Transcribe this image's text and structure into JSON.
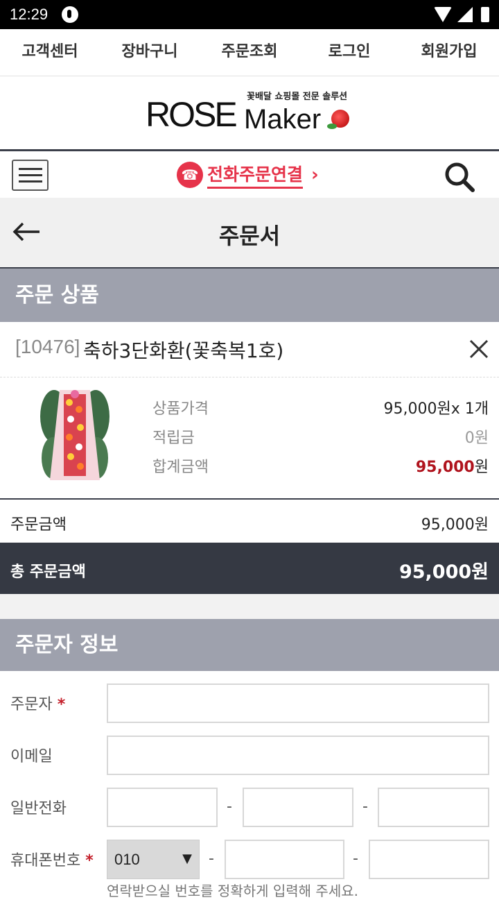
{
  "status_bar": {
    "time": "12:29"
  },
  "top_nav": [
    "고객센터",
    "장바구니",
    "주문조회",
    "로그인",
    "회원가입"
  ],
  "logo": {
    "tagline": "꽃배달 쇼핑몰 전문 솔루션",
    "rose": "ROSE",
    "maker": "Maker"
  },
  "toolbar": {
    "phone_order": "전화주문연결",
    "phone_glyph": "☎",
    "chevron": "›"
  },
  "page": {
    "title": "주문서"
  },
  "order_products": {
    "section_title": "주문 상품",
    "code": "[10476]",
    "name": "축하3단화환(꽃축복1호)",
    "price_label": "상품가격",
    "price_value": "95,000원x 1개",
    "points_label": "적립금",
    "points_value": "0원",
    "subtotal_label": "합계금액",
    "subtotal_amount": "95,000",
    "subtotal_unit": "원"
  },
  "summary": {
    "order_amount_label": "주문금액",
    "order_amount_value": "95,000원",
    "total_label": "총 주문금액",
    "total_value": "95,000원"
  },
  "orderer": {
    "section_title": "주문자 정보",
    "name_label": "주문자",
    "required_mark": "*",
    "email_label": "이메일",
    "phone_label": "일반전화",
    "mobile_label": "휴대폰번호",
    "mobile_prefix": "010",
    "select_arrow": "▼",
    "dash": "-",
    "hint": "연락받으실 번호를 정확하게 입력해 주세요."
  }
}
